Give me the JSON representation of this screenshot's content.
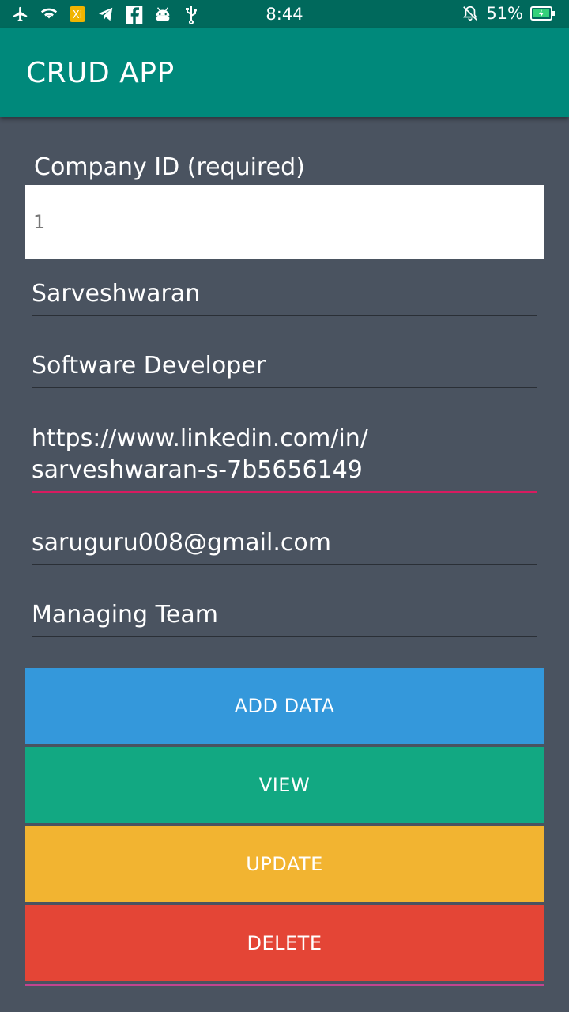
{
  "status_bar": {
    "time": "8:44",
    "battery": "51%",
    "icons_left": [
      "airplane-icon",
      "wifi-icon",
      "app-badge-icon",
      "telegram-icon",
      "facebook-icon",
      "android-icon",
      "usb-icon"
    ],
    "icons_right": [
      "silent-bell-icon",
      "battery-charging-icon"
    ]
  },
  "app_bar": {
    "title": "CRUD APP"
  },
  "form": {
    "company_id_label": "Company ID (required)",
    "company_id_value": "1",
    "name": "Sarveshwaran",
    "role": "Software Developer",
    "linkedin_line1": "https://www.linkedin.com/in/",
    "linkedin_line2": "sarveshwaran-s-7b5656149",
    "email": "saruguru008@gmail.com",
    "team": "Managing Team"
  },
  "buttons": {
    "add": "ADD DATA",
    "view": "VIEW",
    "update": "UPDATE",
    "delete": "DELETE"
  },
  "colors": {
    "status_bar": "#00695c",
    "app_bar": "#00897b",
    "background": "#4a5360",
    "add": "#3498db",
    "view": "#12a882",
    "update": "#f2b431",
    "delete": "#e44536",
    "accent_underline": "#d81b60"
  }
}
